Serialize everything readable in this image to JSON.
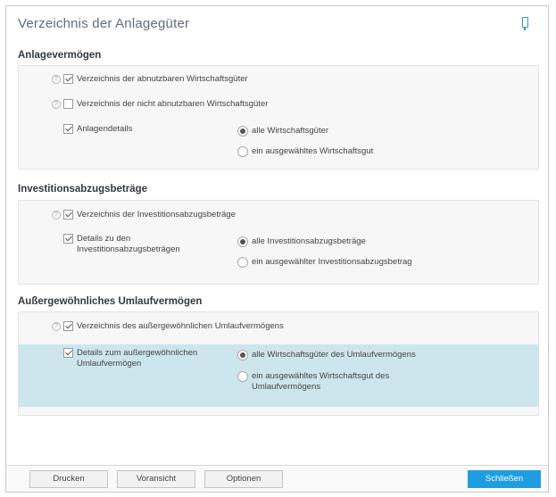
{
  "window": {
    "title": "Verzeichnis der Anlagegüter"
  },
  "sections": {
    "anlage": {
      "title": "Anlagevermögen",
      "cb_abnutzbar": "Verzeichnis der abnutzbaren Wirtschaftsgüter",
      "cb_nicht_abnutzbar": "Verzeichnis der nicht abnutzbaren Wirtschaftsgüter",
      "cb_details": "Anlagendetails",
      "radio_alle": "alle Wirtschaftsgüter",
      "radio_eins": "ein ausgewähltes Wirtschaftsgut"
    },
    "invest": {
      "title": "Investitionsabzugsbeträge",
      "cb_verzeichnis": "Verzeichnis der Investitionsabzugsbeträge",
      "cb_details": "Details zu den\nInvestitionsabzugsbeträgen",
      "radio_alle": "alle Investitionsabzugsbeträge",
      "radio_eins": "ein ausgewählter Investitionsabzugsbetrag"
    },
    "umlauf": {
      "title": "Außergewöhnliches Umlaufvermögen",
      "cb_verzeichnis": "Verzeichnis des außergewöhnlichen Umlaufvermögens",
      "cb_details": "Details zum außergewöhnlichen\nUmlaufvermögen",
      "radio_alle": "alle Wirtschaftsgüter des Umlaufvermögens",
      "radio_eins": "ein ausgewähltes Wirtschaftsgut des\nUmlaufvermögens"
    }
  },
  "footer": {
    "print": "Drucken",
    "preview": "Voransicht",
    "options": "Optionen",
    "close": "Schließen"
  },
  "colors": {
    "accent": "#1e9ee0",
    "highlight": "#cde6ee"
  }
}
